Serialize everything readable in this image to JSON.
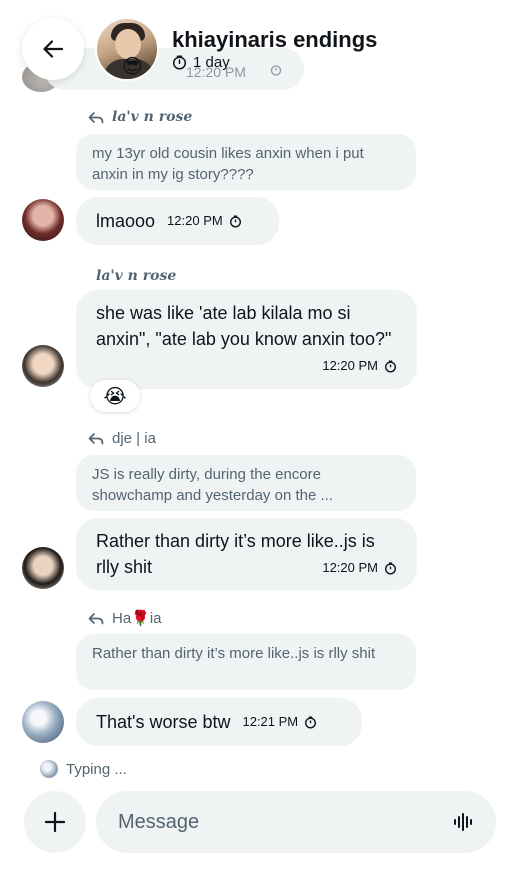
{
  "header": {
    "title": "khiayinaris endings",
    "subtitle": "1 day",
    "back_icon": "arrow-left-icon",
    "previous_message_time": "12:20 PM",
    "avatar_emoji": "😎"
  },
  "messages": [
    {
      "reply_to": "la'v n rose",
      "quoted_text": "my 13yr old cousin likes anxin when i put anxin in my ig story????",
      "text": "lmaooo",
      "time": "12:20 PM"
    },
    {
      "sender": "la'v n rose",
      "text": "she was like 'ate lab kilala mo si anxin\", \"ate lab you know anxin too?\"",
      "time": "12:20 PM",
      "reaction": "😭"
    },
    {
      "reply_to": "dje | ia",
      "quoted_text": "JS is really dirty, during the encore showchamp and yesterday on the ...",
      "text": "Rather than dirty it’s more like..js is rlly shit",
      "time": "12:20 PM"
    },
    {
      "reply_to": "Ha🌹ia",
      "quoted_text": "Rather than dirty it’s more like..js is rlly shit",
      "text": "That's worse btw",
      "time": "12:21 PM"
    }
  ],
  "typing": {
    "label": "Typing ..."
  },
  "composer": {
    "placeholder": "Message",
    "add_icon": "plus-icon",
    "voice_icon": "voice-waveform-icon"
  },
  "colors": {
    "bubble": "#eff3f4",
    "secondary_text": "#536471",
    "primary_text": "#0f1419"
  }
}
